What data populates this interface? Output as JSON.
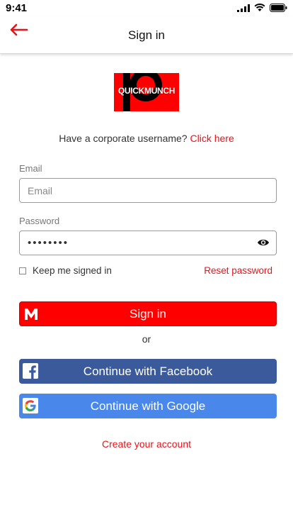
{
  "status_bar": {
    "time": "9:41"
  },
  "nav": {
    "title": "Sign in"
  },
  "logo": {
    "text": "QUICKMUNCH"
  },
  "corporate": {
    "question": "Have a corporate username?",
    "link": "Click here"
  },
  "email": {
    "label": "Email",
    "placeholder": "Email",
    "value": ""
  },
  "password": {
    "label": "Password",
    "value": "••••••••"
  },
  "keep_signed_in": {
    "label": "Keep me signed in",
    "checked": false
  },
  "reset_password": "Reset password",
  "sign_in_button": "Sign in",
  "or_text": "or",
  "facebook_button": "Continue with Facebook",
  "google_button": "Continue with Google",
  "create_account": "Create your account",
  "colors": {
    "accent": "#ff0000",
    "link": "#e8141b",
    "facebook": "#3b5a9b",
    "google": "#4a87eb"
  },
  "icons": [
    "back-arrow-icon",
    "eye-icon",
    "m-brand-icon",
    "facebook-icon",
    "google-icon",
    "signal-icon",
    "wifi-icon",
    "battery-icon"
  ]
}
